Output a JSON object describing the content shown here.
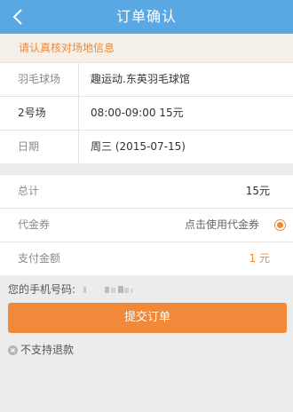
{
  "header": {
    "title": "订单确认",
    "back_icon": "chevron-left-icon",
    "color": "#5aa8e3"
  },
  "notice": {
    "text": "请认真核对场地信息",
    "color": "#ee8b3a"
  },
  "venue_info": {
    "venue_label": "羽毛球场",
    "venue_value": "趣运动.东英羽毛球馆",
    "court_label": "2号场",
    "court_value": "08:00-09:00 15元",
    "date_label": "日期",
    "date_value": "周三 (2015-07-15)"
  },
  "payment": {
    "total_label": "总计",
    "total_value": "15元",
    "voucher_label": "代金券",
    "voucher_action": "点击使用代金券",
    "voucher_selected": true,
    "amount_label": "支付金额",
    "amount_value": "1 元"
  },
  "phone": {
    "label": "您的手机号码:"
  },
  "submit": {
    "label": "提交订单",
    "color": "#f0893a"
  },
  "refund": {
    "icon": "close-circle-icon",
    "text": "不支持退款"
  }
}
